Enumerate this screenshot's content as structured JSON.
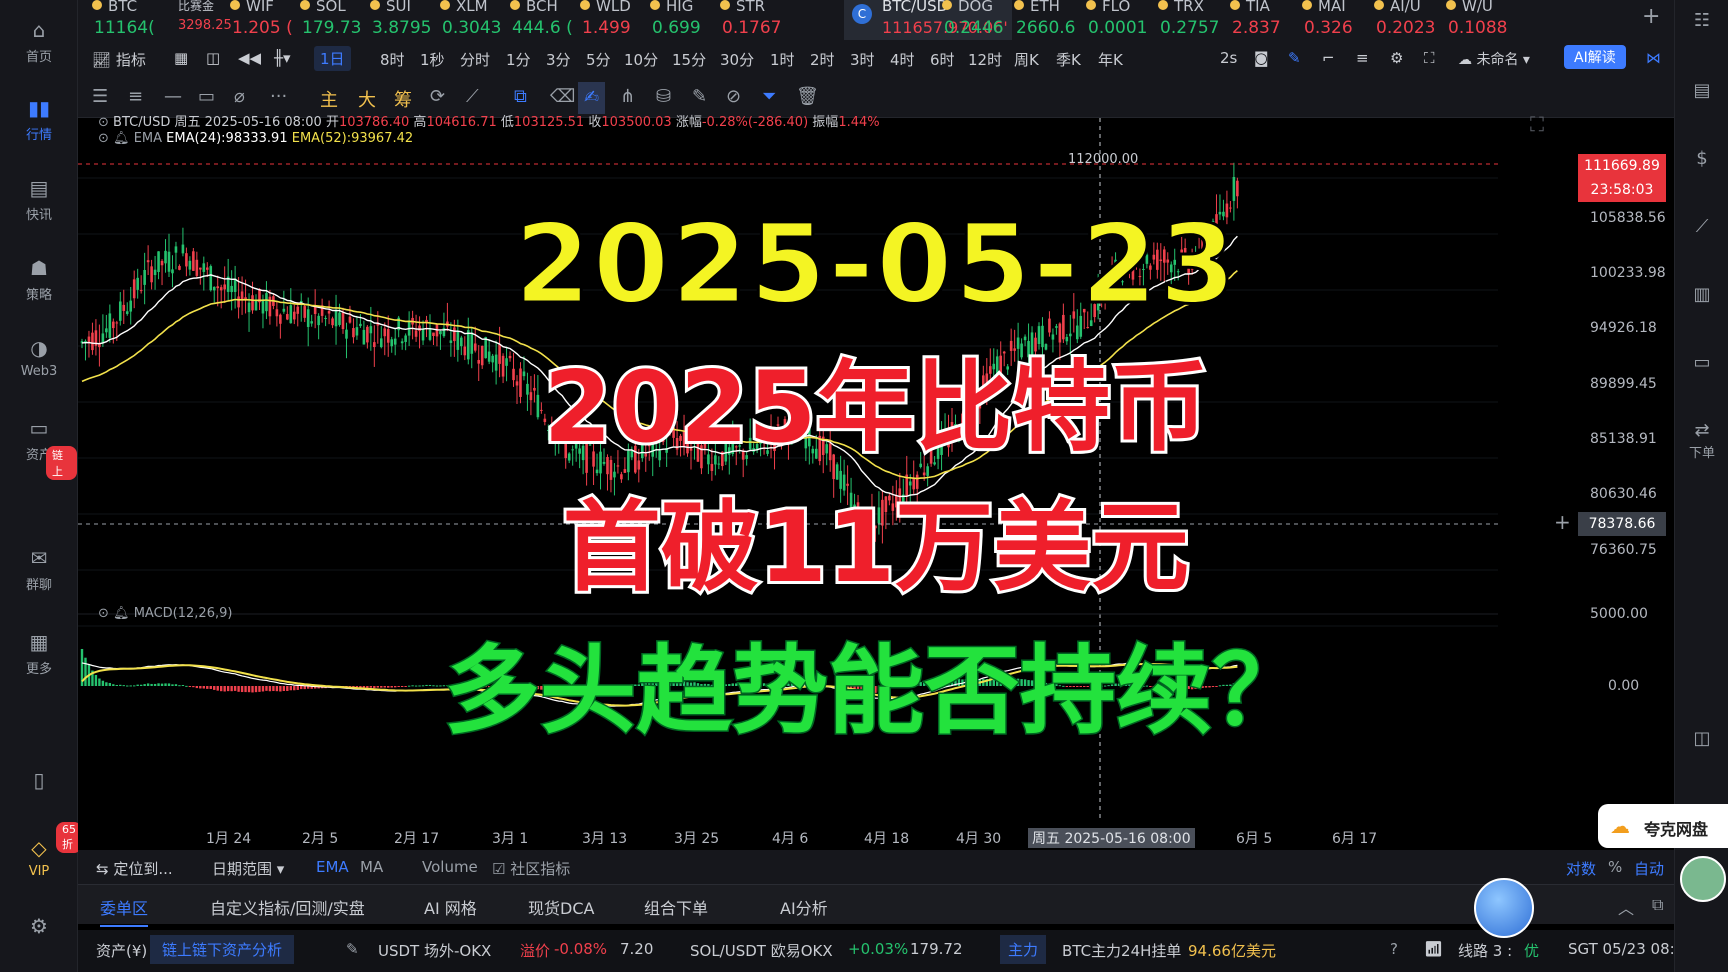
{
  "nav": [
    {
      "label": "首页",
      "icon": "home-icon"
    },
    {
      "label": "行情",
      "icon": "chart-bars-icon",
      "active": true
    },
    {
      "label": "快讯",
      "icon": "news-icon"
    },
    {
      "label": "策略",
      "icon": "robot-icon"
    },
    {
      "label": "Web3",
      "icon": "web3-icon"
    },
    {
      "label": "资产",
      "icon": "wallet-icon"
    },
    {
      "label": "群聊",
      "icon": "chat-icon"
    },
    {
      "label": "更多",
      "icon": "grid-icon"
    }
  ],
  "nav_badge_asset": "链上",
  "vip": {
    "label": "VIP",
    "badge": "65折"
  },
  "tickers": [
    {
      "name": "BTC",
      "price": "11164(",
      "dir": "up"
    },
    {
      "name": "比赛金",
      "price": "3298.25",
      "dir": "dn"
    },
    {
      "name": "WIF",
      "price": "1.205 (",
      "dir": "dn"
    },
    {
      "name": "SOL",
      "price": "179.73",
      "dir": "up"
    },
    {
      "name": "SUI",
      "price": "3.8795",
      "dir": "up"
    },
    {
      "name": "XLM",
      "price": "0.3043",
      "dir": "up"
    },
    {
      "name": "BCH",
      "price": "444.6 (",
      "dir": "up"
    },
    {
      "name": "WLD",
      "price": "1.499",
      "dir": "dn"
    },
    {
      "name": "HIG",
      "price": "0.699",
      "dir": "up"
    },
    {
      "name": "STR",
      "price": "0.1767",
      "dir": "dn"
    }
  ],
  "active_ticker": {
    "name": "BTC/USD",
    "price": "111657.97",
    "change": "-0.06'"
  },
  "tickers_right": [
    {
      "name": "DOG",
      "price": "0.2446",
      "dir": "up"
    },
    {
      "name": "ETH",
      "price": "2660.6",
      "dir": "up"
    },
    {
      "name": "FLO",
      "price": "0.0001",
      "dir": "up"
    },
    {
      "name": "TRX",
      "price": "0.2757",
      "dir": "up"
    },
    {
      "name": "TIA",
      "price": "2.837",
      "dir": "dn"
    },
    {
      "name": "MAI",
      "price": "0.326",
      "dir": "dn"
    },
    {
      "name": "AI/U",
      "price": "0.2023",
      "dir": "dn"
    },
    {
      "name": "W/U",
      "price": "0.1088",
      "dir": "dn"
    }
  ],
  "timeframes": {
    "indicator": "指标",
    "items": [
      "1日",
      "8时",
      "1秒",
      "分时",
      "1分",
      "3分",
      "5分",
      "10分",
      "15分",
      "30分",
      "1时",
      "2时",
      "3时",
      "4时",
      "6时",
      "12时",
      "周K",
      "季K",
      "年K"
    ],
    "selected": "1日",
    "refresh": "2s",
    "layout_name": "未命名",
    "ai_button": "AI解读"
  },
  "tools": [
    "主",
    "大",
    "筹"
  ],
  "legend": {
    "symbol": "BTC/USD",
    "date": "周五 2025-05-16 08:00",
    "open_label": "开",
    "open": "103786.40",
    "high_label": "高",
    "high": "104616.71",
    "low_label": "低",
    "low": "103125.51",
    "close_label": "收",
    "close": "103500.03",
    "chg_label": "涨幅",
    "chg": "-0.28%(-286.40)",
    "amp_label": "振幅",
    "amp": "1.44%",
    "ema_label": "EMA",
    "ema24": "EMA(24):98333.91",
    "ema52": "EMA(52):93967.42",
    "macd_label": "MACD(12,26,9)"
  },
  "overlay": {
    "date": "2025-05-23",
    "line1": "2025年比特币",
    "line2": "首破11万美元",
    "line3": "多头趋势能否持续？"
  },
  "price_tags": {
    "last": "111669.89",
    "countdown": "23:58:03",
    "cursor": "78378.66",
    "marker": "112000.00"
  },
  "yaxis": [
    "105838.56",
    "100233.98",
    "94926.18",
    "89899.45",
    "85138.91",
    "80630.46",
    "76360.75",
    "5000.00",
    "0.00"
  ],
  "xaxis": [
    "1月 24",
    "2月 5",
    "2月 17",
    "3月 1",
    "3月 13",
    "3月 25",
    "4月 6",
    "4月 18",
    "4月 30",
    "6月 5",
    "6月 17"
  ],
  "cursor_date": "周五 2025-05-16 08:00",
  "bottom_tabs": {
    "locate": "定位到...",
    "range": "日期范围",
    "ema": "EMA",
    "ma": "MA",
    "volume": "Volume",
    "community": "社区指标",
    "log": "对数",
    "pct": "%",
    "auto": "自动"
  },
  "panel_tabs": [
    "委单区",
    "自定义指标/回测/实盘",
    "AI 网格",
    "现货DCA",
    "组合下单",
    "AI分析"
  ],
  "status": {
    "assets": "资产(¥)",
    "analysis": "链上链下资产分析",
    "usdt": "USDT 场外-OKX",
    "usdt_label": "溢价",
    "usdt_prem": "-0.08%",
    "usdt_price": "7.20",
    "sol": "SOL/USDT 欧易OKX",
    "sol_chg": "+0.03%",
    "sol_price": "179.72",
    "main": "主力",
    "btc_order": "BTC主力24H挂单",
    "btc_amount": "94.66亿美元",
    "line": "线路 3 :",
    "quality": "优",
    "time": "SGT 05/23 08:01:56"
  },
  "cloud": "夸克网盘",
  "right_rail": {
    "order": "下单"
  },
  "colors": {
    "up": "#25c26e",
    "down": "#f0404c",
    "accent": "#3d7bff",
    "ema24": "#ffffff",
    "ema52": "#f2e14b"
  },
  "chart_data": {
    "type": "candlestick",
    "series": [
      {
        "name": "EMA(24)",
        "values": [
          98333.91
        ]
      },
      {
        "name": "EMA(52)",
        "values": [
          93967.42
        ]
      }
    ],
    "ohlc_selected": {
      "date": "2025-05-16",
      "open": 103786.4,
      "high": 104616.71,
      "low": 103125.51,
      "close": 103500.03
    },
    "last_price": 111669.89,
    "ylim": [
      74000,
      114000
    ]
  }
}
